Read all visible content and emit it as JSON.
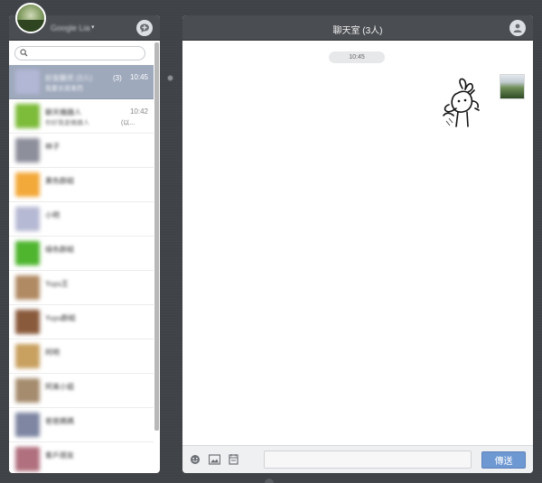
{
  "profile": {
    "name": "Google Lia",
    "caret": "▾"
  },
  "search": {
    "placeholder": ""
  },
  "chats": [
    {
      "name": "好友聊天 (3人)",
      "preview": "我要去買東西",
      "count": "(3)",
      "time": "10:45",
      "preview_tail": "",
      "avatar_color": "#b3b7d6",
      "active": true
    },
    {
      "name": "聊天機器人",
      "preview": "你好我是機器人",
      "count": "",
      "time": "10:42",
      "preview_tail": "(以...",
      "avatar_color": "#7dbb3a",
      "active": false
    },
    {
      "name": "林子",
      "preview": "",
      "count": "",
      "time": "",
      "preview_tail": "",
      "avatar_color": "#8d8f9b",
      "active": false
    },
    {
      "name": "黃色群組",
      "preview": "",
      "count": "",
      "time": "",
      "preview_tail": "",
      "avatar_color": "#f3a93a",
      "active": false
    },
    {
      "name": "小明",
      "preview": "",
      "count": "",
      "time": "",
      "preview_tail": "",
      "avatar_color": "#b6b9d3",
      "active": false
    },
    {
      "name": "綠色群組",
      "preview": "",
      "count": "",
      "time": "",
      "preview_tail": "",
      "avatar_color": "#4fb52f",
      "active": false
    },
    {
      "name": "Yuyu王",
      "preview": "",
      "count": "",
      "time": "",
      "preview_tail": "",
      "avatar_color": "#b08a63",
      "active": false
    },
    {
      "name": "Yuyu群組",
      "preview": "",
      "count": "",
      "time": "",
      "preview_tail": "",
      "avatar_color": "#8a5a3c",
      "active": false
    },
    {
      "name": "阿明",
      "preview": "",
      "count": "",
      "time": "",
      "preview_tail": "",
      "avatar_color": "#c8a060",
      "active": false
    },
    {
      "name": "阿美小姐",
      "preview": "",
      "count": "",
      "time": "",
      "preview_tail": "",
      "avatar_color": "#a58c6e",
      "active": false
    },
    {
      "name": "爸爸媽媽",
      "preview": "",
      "count": "",
      "time": "",
      "preview_tail": "",
      "avatar_color": "#7e86a2",
      "active": false
    },
    {
      "name": "客戶朋友",
      "preview": "",
      "count": "",
      "time": "",
      "preview_tail": "",
      "avatar_color": "#b0707e",
      "active": false
    }
  ],
  "room": {
    "title": "聊天室 (3人)"
  },
  "messages": {
    "timestamp": "10:45"
  },
  "composer": {
    "input_placeholder": "",
    "send_label": "傳送"
  },
  "icons": {
    "add_chat": "add-chat-icon",
    "members": "user-icon",
    "emoji": "smiley-icon",
    "image": "image-icon",
    "file": "file-icon"
  },
  "colors": {
    "header": "#4a4d51",
    "active_row": "#9ea9bc",
    "send_button": "#6e98d2"
  }
}
